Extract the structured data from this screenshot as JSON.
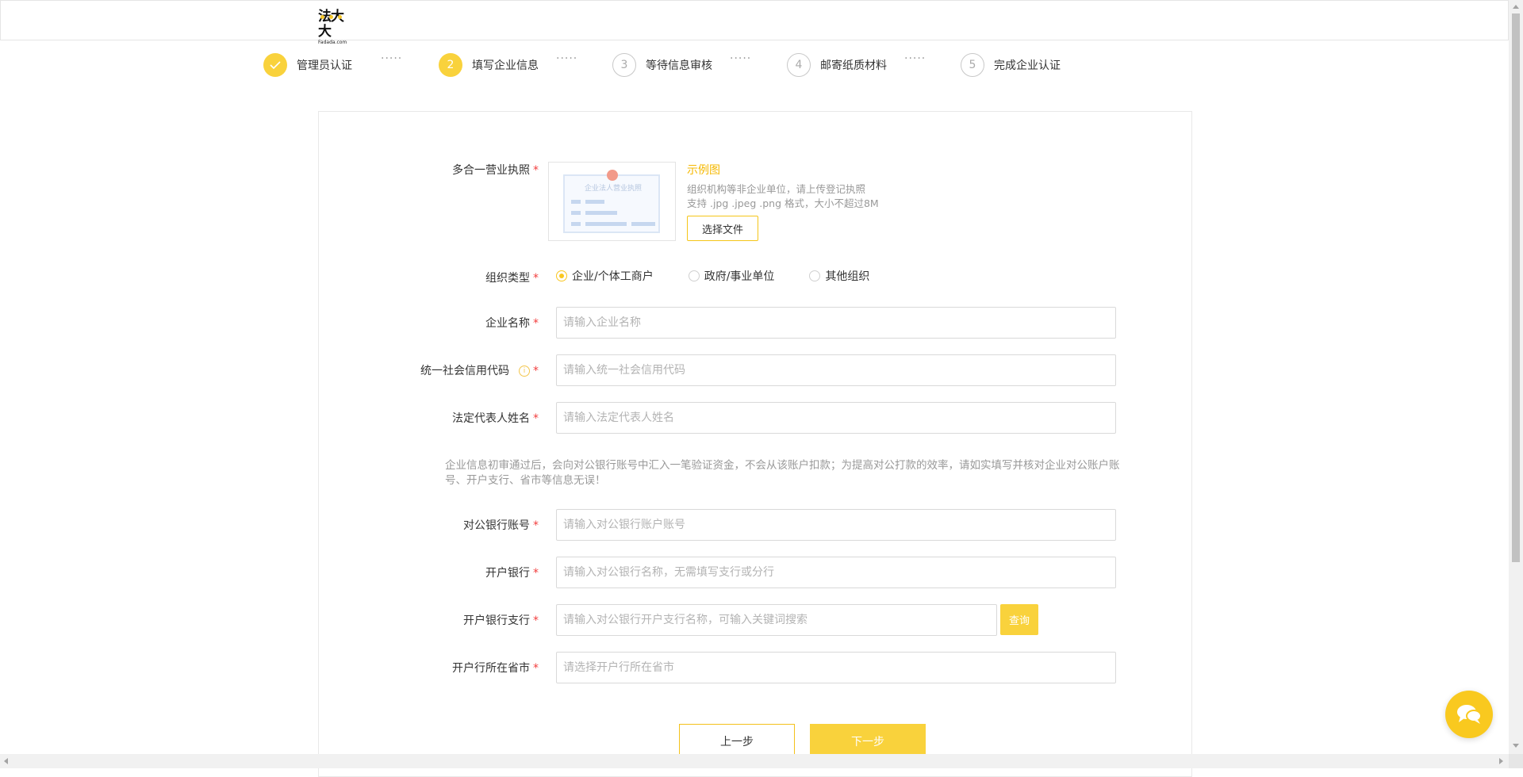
{
  "header": {
    "logo_text": "法大大",
    "logo_sub": "Fadada.com"
  },
  "steps": [
    {
      "index": "✓",
      "label": "管理员认证",
      "state": "done"
    },
    {
      "index": "2",
      "label": "填写企业信息",
      "state": "active"
    },
    {
      "index": "3",
      "label": "等待信息审核",
      "state": "pending"
    },
    {
      "index": "4",
      "label": "邮寄纸质材料",
      "state": "pending"
    },
    {
      "index": "5",
      "label": "完成企业认证",
      "state": "pending"
    }
  ],
  "step_separator": "·····",
  "form": {
    "license": {
      "label": "多合一营业执照",
      "image_title": "企业法人营业执照",
      "example_link": "示例图",
      "hint1": "组织机构等非企业单位，请上传登记执照",
      "hint2": "支持 .jpg .jpeg .png 格式，大小不超过8M",
      "file_button": "选择文件"
    },
    "org_type": {
      "label": "组织类型",
      "options": [
        "企业/个体工商户",
        "政府/事业单位",
        "其他组织"
      ],
      "selected": "企业/个体工商户"
    },
    "company_name": {
      "label": "企业名称",
      "placeholder": "请输入企业名称"
    },
    "credit_code": {
      "label": "统一社会信用代码",
      "placeholder": "请输入统一社会信用代码",
      "info_icon": "i"
    },
    "legal_rep": {
      "label": "法定代表人姓名",
      "placeholder": "请输入法定代表人姓名"
    },
    "notice": "企业信息初审通过后，会向对公银行账号中汇入一笔验证资金，不会从该账户扣款；为提高对公打款的效率，请如实填写并核对企业对公账户账号、开户支行、省市等信息无误！",
    "bank_account": {
      "label": "对公银行账号",
      "placeholder": "请输入对公银行账户账号"
    },
    "bank": {
      "label": "开户银行",
      "placeholder": "请输入对公银行名称，无需填写支行或分行"
    },
    "bank_branch": {
      "label": "开户银行支行",
      "placeholder": "请输入对公银行开户支行名称，可输入关键词搜索",
      "query_button": "查询"
    },
    "bank_region": {
      "label": "开户行所在省市",
      "placeholder": "请选择开户行所在省市"
    },
    "required_mark": "*"
  },
  "actions": {
    "prev": "上一步",
    "next": "下一步"
  },
  "colors": {
    "accent": "#f9d23c",
    "required": "#f23e3e"
  },
  "icons": {
    "chat": "chat-bubbles-icon",
    "check": "check-icon"
  }
}
